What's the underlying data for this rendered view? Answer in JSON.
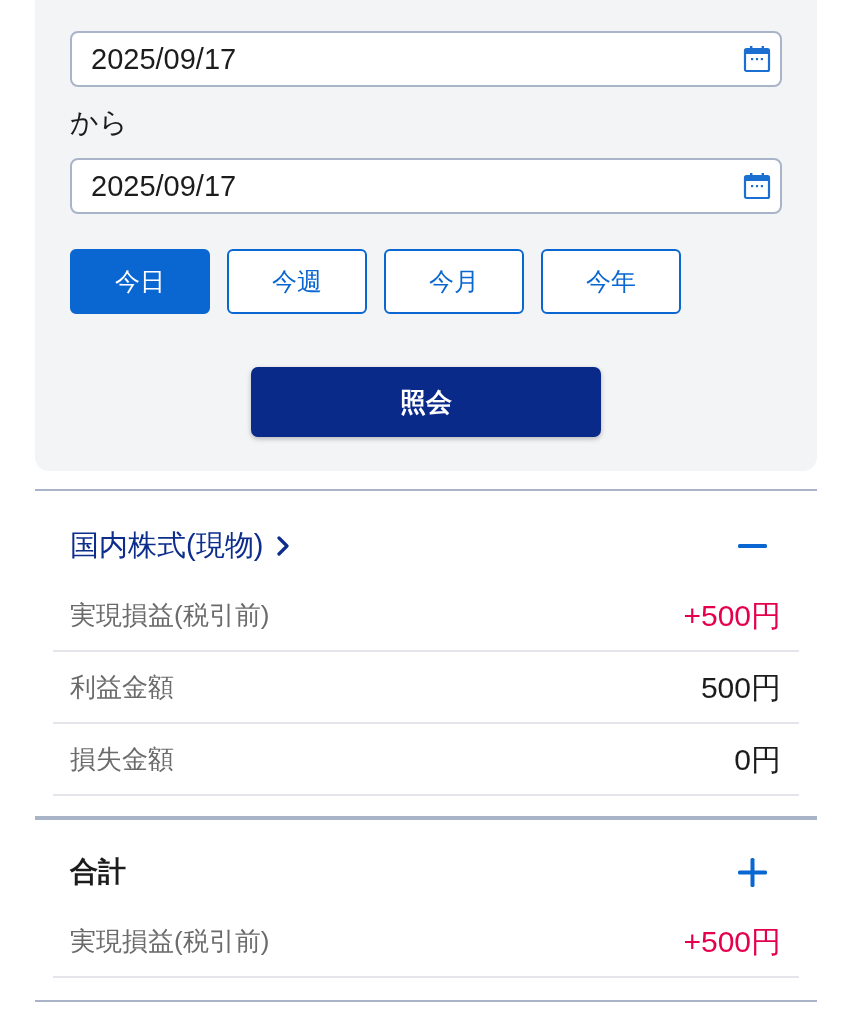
{
  "date_range": {
    "start": {
      "value": "2025/09/17"
    },
    "separator": "から",
    "end": {
      "value": "2025/09/17"
    }
  },
  "period_buttons": [
    {
      "label": "今日",
      "selected": true
    },
    {
      "label": "今週",
      "selected": false
    },
    {
      "label": "今月",
      "selected": false
    },
    {
      "label": "今年",
      "selected": false
    }
  ],
  "query_button": {
    "label": "照会"
  },
  "sections": [
    {
      "title": "国内株式(現物)",
      "kind": "link",
      "expanded": true,
      "rows": [
        {
          "label": "実現損益(税引前)",
          "value": "+500円",
          "color": "#e5004f"
        },
        {
          "label": "利益金額",
          "value": "500円",
          "color": "#1c1c1c"
        },
        {
          "label": "損失金額",
          "value": "0円",
          "color": "#1c1c1c"
        }
      ]
    },
    {
      "title": "合計",
      "kind": "plain",
      "expanded": false,
      "rows": [
        {
          "label": "実現損益(税引前)",
          "value": "+500円",
          "color": "#e5004f"
        }
      ]
    }
  ]
}
